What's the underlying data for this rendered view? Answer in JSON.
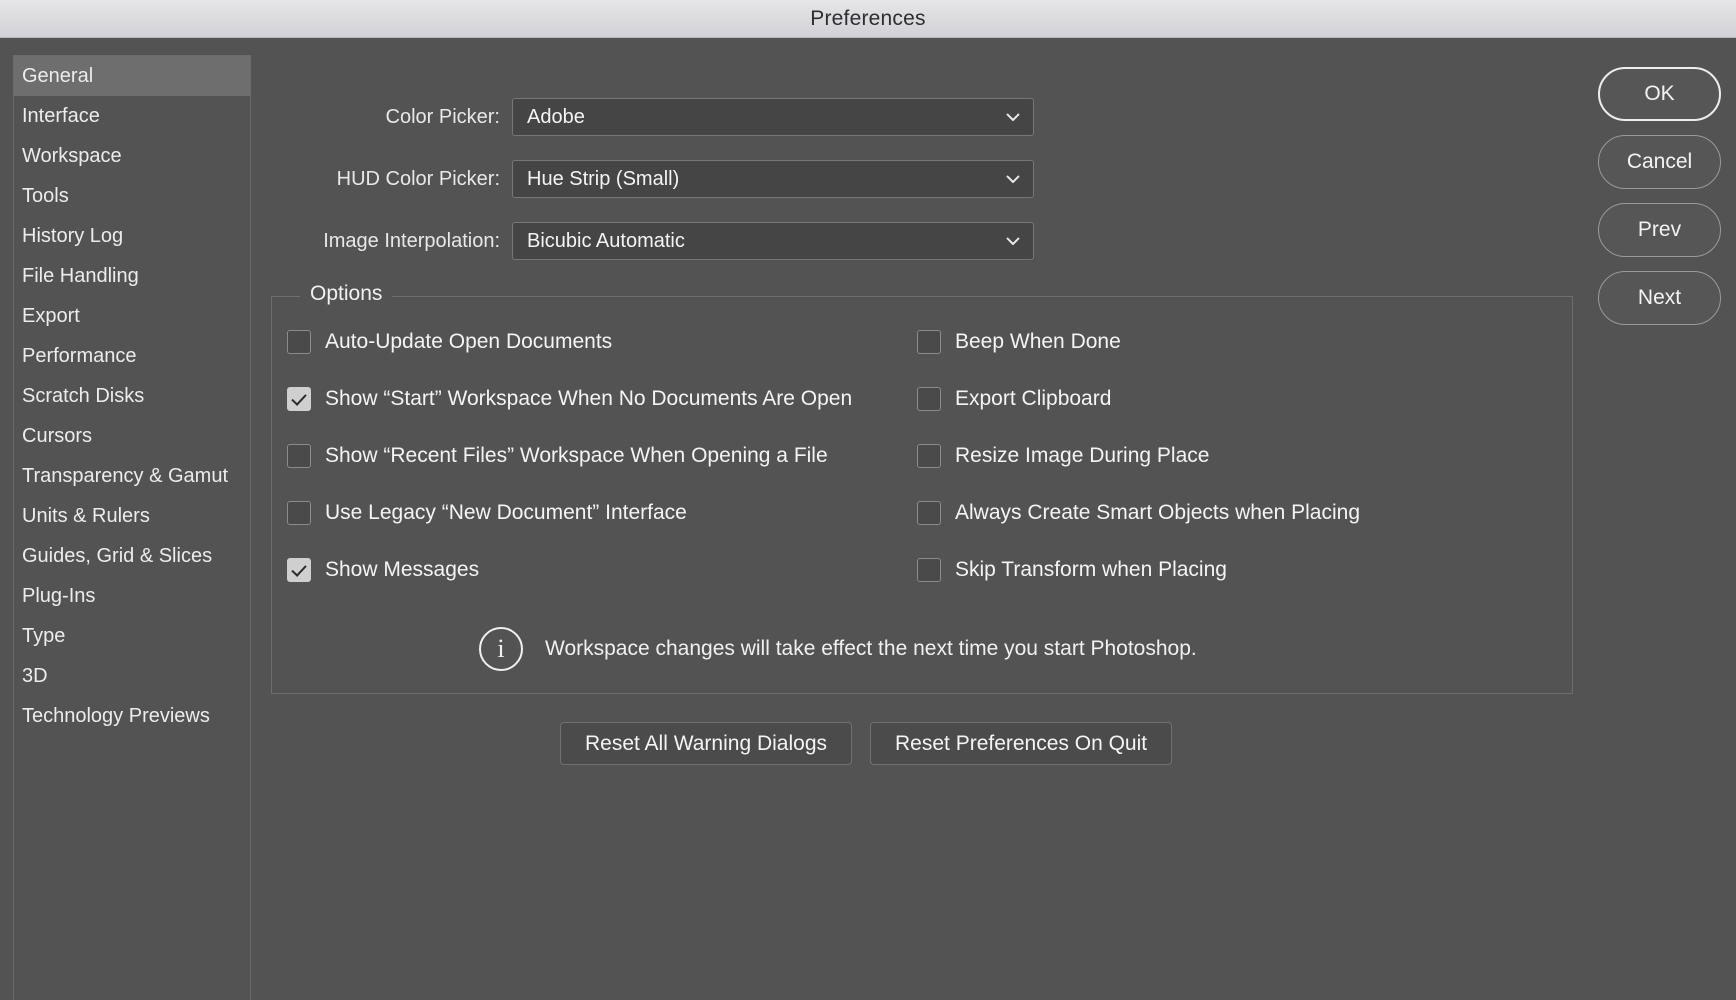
{
  "window": {
    "title": "Preferences"
  },
  "sidebar": {
    "items": [
      {
        "label": "General",
        "selected": true
      },
      {
        "label": "Interface",
        "selected": false
      },
      {
        "label": "Workspace",
        "selected": false
      },
      {
        "label": "Tools",
        "selected": false
      },
      {
        "label": "History Log",
        "selected": false
      },
      {
        "label": "File Handling",
        "selected": false
      },
      {
        "label": "Export",
        "selected": false
      },
      {
        "label": "Performance",
        "selected": false
      },
      {
        "label": "Scratch Disks",
        "selected": false
      },
      {
        "label": "Cursors",
        "selected": false
      },
      {
        "label": "Transparency & Gamut",
        "selected": false
      },
      {
        "label": "Units & Rulers",
        "selected": false
      },
      {
        "label": "Guides, Grid & Slices",
        "selected": false
      },
      {
        "label": "Plug-Ins",
        "selected": false
      },
      {
        "label": "Type",
        "selected": false
      },
      {
        "label": "3D",
        "selected": false
      },
      {
        "label": "Technology Previews",
        "selected": false
      }
    ]
  },
  "fields": [
    {
      "label": "Color Picker:",
      "value": "Adobe",
      "icon": "chevron-down-icon"
    },
    {
      "label": "HUD Color Picker:",
      "value": "Hue Strip (Small)",
      "icon": "chevron-down-icon"
    },
    {
      "label": "Image Interpolation:",
      "value": "Bicubic Automatic",
      "icon": "chevron-down-icon"
    }
  ],
  "options_group": {
    "legend": "Options",
    "left_column": [
      {
        "label": "Auto-Update Open Documents",
        "checked": false
      },
      {
        "label": "Show “Start” Workspace When No Documents Are Open",
        "checked": true
      },
      {
        "label": "Show “Recent Files” Workspace When Opening a File",
        "checked": false
      },
      {
        "label": "Use Legacy “New Document” Interface",
        "checked": false
      },
      {
        "label": "Show Messages",
        "checked": true
      }
    ],
    "right_column": [
      {
        "label": "Beep When Done",
        "checked": false
      },
      {
        "label": "Export Clipboard",
        "checked": false
      },
      {
        "label": "Resize Image During Place",
        "checked": false
      },
      {
        "label": "Always Create Smart Objects when Placing",
        "checked": false
      },
      {
        "label": "Skip Transform when Placing",
        "checked": false
      }
    ],
    "note": {
      "icon": "info-circle-icon",
      "icon_glyph": "i",
      "text": "Workspace changes will take effect the next time you start Photoshop."
    }
  },
  "reset_buttons": [
    {
      "label": "Reset All Warning Dialogs"
    },
    {
      "label": "Reset Preferences On Quit"
    }
  ],
  "actions": [
    {
      "label": "OK",
      "default": true
    },
    {
      "label": "Cancel",
      "default": false
    },
    {
      "label": "Prev",
      "default": false
    },
    {
      "label": "Next",
      "default": false
    }
  ],
  "colors": {
    "dialog_background": "#535353",
    "titlebar_background": "#dbdadd",
    "titlebar_text": "#2d2d33",
    "sidebar_selected": "#6e6e6e",
    "field_background": "#454545",
    "field_border": "#777777",
    "text": "#f2f2f2",
    "checkbox_checked_fill": "#cfcfcf",
    "group_border": "#6e6e6e"
  }
}
